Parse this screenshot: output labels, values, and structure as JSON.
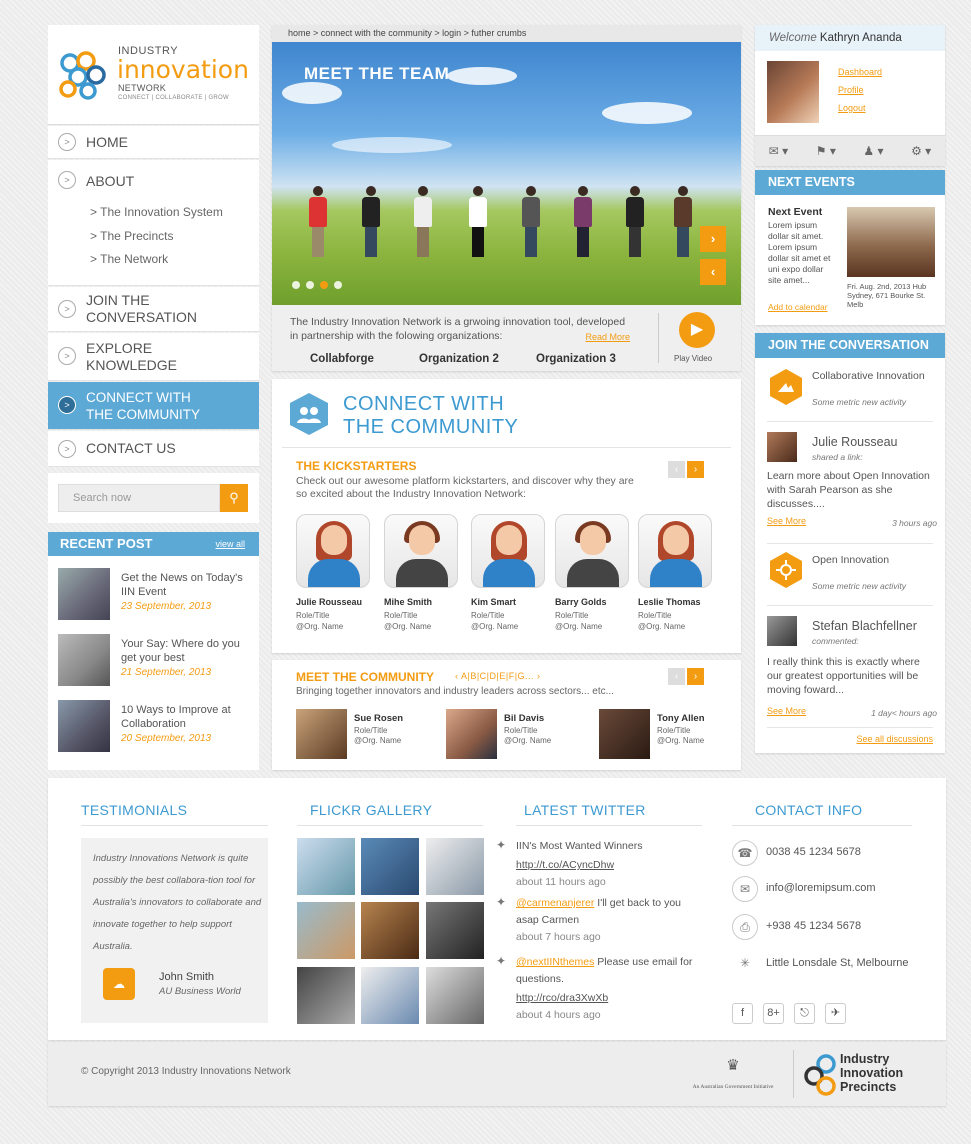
{
  "logo": {
    "line1": "INDUSTRY",
    "line2": "innovation",
    "line3": "NETWORK",
    "tagline": "CONNECT  |  COLLABORATE  |  GROW"
  },
  "nav": {
    "home": "HOME",
    "about": "ABOUT",
    "sub": [
      "> The Innovation System",
      "> The Precincts",
      "> The Network"
    ],
    "join1": "JOIN THE",
    "join2": "CONVERSATION",
    "explore1": "EXPLORE",
    "explore2": "KNOWLEDGE",
    "connect1": "CONNECT WITH",
    "connect2": "THE COMMUNITY",
    "contact": "CONTACT US"
  },
  "search": {
    "placeholder": "Search now"
  },
  "recent": {
    "title": "RECENT POST",
    "view_all": "view all",
    "posts": [
      {
        "title": "Get the News on Today's IIN Event",
        "date": "23 September, 2013"
      },
      {
        "title": "Your Say: Where do you get your best",
        "date": "21 September, 2013"
      },
      {
        "title": "10 Ways to Improve at Collaboration",
        "date": "20 September, 2013"
      }
    ]
  },
  "breadcrumb": "home > connect with the community > login > futher crumbs",
  "hero": {
    "title": "MEET THE TEAM",
    "text": "The Industry Innovation Network is a grwoing innovation tool, developed in partnership with the folowing organizations:",
    "read_more": "Read More",
    "orgs": [
      "Collabforge",
      "Organization 2",
      "Organization 3"
    ],
    "play": "Play Video",
    "next": "›",
    "prev": "‹"
  },
  "community": {
    "title1": "CONNECT WITH",
    "title2": "THE COMMUNITY",
    "ks_title": "THE KICKSTARTERS",
    "ks_desc": "Check out our awesome platform kickstarters, and discover why they are so excited about the Industry Innovation Network:",
    "people": [
      {
        "name": "Julie Rousseau",
        "role": "Role/Title",
        "org": "@Org. Name"
      },
      {
        "name": "Mihe Smith",
        "role": "Role/Title",
        "org": "@Org. Name"
      },
      {
        "name": "Kim Smart",
        "role": "Role/Title",
        "org": "@Org. Name"
      },
      {
        "name": "Barry Golds",
        "role": "Role/Title",
        "org": "@Org. Name"
      },
      {
        "name": "Leslie Thomas",
        "role": "Role/Title",
        "org": "@Org. Name"
      }
    ]
  },
  "meet": {
    "title": "MEET THE COMMUNITY",
    "alpha": "‹ A|B|C|D|E|F|G... ›",
    "desc": "Bringing together innovators and industry leaders across sectors... etc...",
    "members": [
      {
        "name": "Sue Rosen",
        "role": "Role/Title",
        "org": "@Org. Name"
      },
      {
        "name": "Bil Davis",
        "role": "Role/Title",
        "org": "@Org. Name"
      },
      {
        "name": "Tony Allen",
        "role": "Role/Title",
        "org": "@Org. Name"
      }
    ]
  },
  "welcome": {
    "prefix": "Welcome",
    "name": "Kathryn Ananda",
    "links": [
      "Dashboard",
      "Profile",
      "Logout"
    ],
    "toolbar": [
      "✉ ▾",
      "⚑ ▾",
      "♟ ▾",
      "⚙ ▾"
    ]
  },
  "events": {
    "title": "NEXT EVENTS",
    "event_title": "Next Event",
    "event_desc": "Lorem ipsum dollar sit amet. Lorem ipsum dollar sit amet et uni expo dollar site amet...",
    "event_meta": "Fri. Aug. 2nd, 2013 Hub Sydney, 671 Bourke St. Melb",
    "add": "Add to calendar"
  },
  "join": {
    "title": "JOIN THE CONVERSATION",
    "g1_name": "Collaborative Innovation",
    "g1_sub": "Some metric new activity",
    "p1_name": "Julie Rousseau",
    "p1_action": "shared a link:",
    "p1_body": "Learn more about Open Innovation with Sarah Pearson as she discusses....",
    "p1_more": "See More",
    "p1_time": "3 hours ago",
    "g2_name": "Open Innovation",
    "g2_sub": "Some metric new activity",
    "p2_name": "Stefan Blachfellner",
    "p2_action": "commented:",
    "p2_body": "I really think this is exactly where our greatest opportunities will be moving foward...",
    "p2_more": "See More",
    "p2_time": "1 day< hours ago",
    "all": "See all discussions"
  },
  "footer": {
    "testimonials": "TESTIMONIALS",
    "quote": "Industry Innovations Network is quite possibly the best collabora-tion tool for Australia's innovators to collaborate and innovate together to help support Australia.",
    "q_name": "John Smith",
    "q_company": "AU Business World",
    "flickr": "FLICKR GALLERY",
    "twitter": "LATEST TWITTER",
    "tweets": [
      {
        "line1": "IIN's Most Wanted Winners",
        "link": "http://t.co/ACyncDhw",
        "time": "about 11 hours ago"
      },
      {
        "handle": "@carmenanjerer",
        "text": " I'll get back to you asap Carmen",
        "time": "about 7 hours ago"
      },
      {
        "handle": "@nextIINthemes",
        "text": " Please use email for questions.",
        "link": "http://rco/dra3XwXb",
        "time": "about 4 hours ago"
      }
    ],
    "contact": "CONTACT INFO",
    "contacts": [
      "0038 45 1234 5678",
      "info@loremipsum.com",
      "+938 45 1234 5678",
      "Little Lonsdale St, Melbourne"
    ],
    "social": [
      "f",
      "8+",
      "⎋",
      "✈"
    ]
  },
  "copyright": "© Copyright 2013 Industry Innovations Network",
  "gov": "An Australian Government Initiative",
  "iip": {
    "l1": "Industry",
    "l2": "Innovation",
    "l3": "Precincts"
  },
  "colors": {
    "blue": "#5da9d6",
    "orange": "#f39c12"
  }
}
